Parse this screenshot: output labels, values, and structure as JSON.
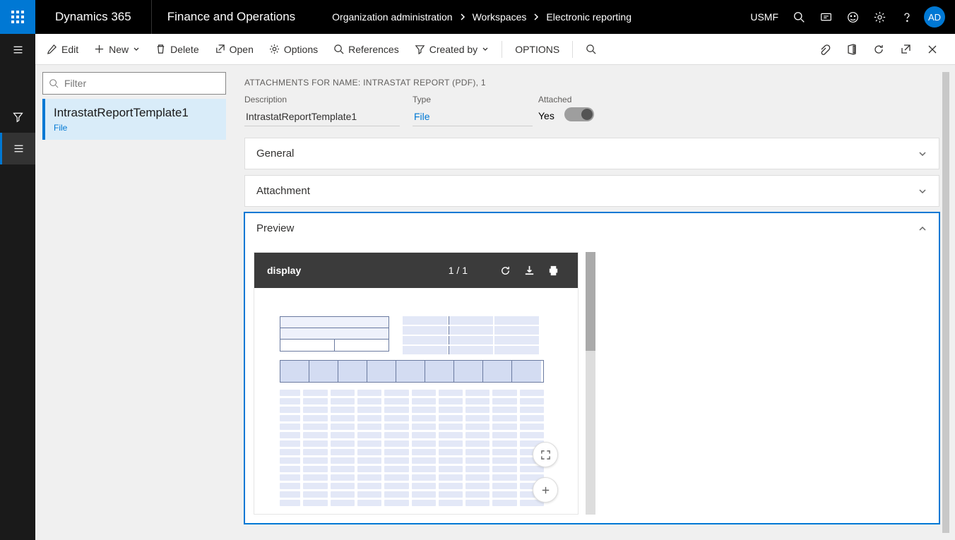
{
  "header": {
    "brand": "Dynamics 365",
    "module": "Finance and Operations",
    "breadcrumb": [
      "Organization administration",
      "Workspaces",
      "Electronic reporting"
    ],
    "entity": "USMF",
    "avatar": "AD"
  },
  "actionbar": {
    "edit": "Edit",
    "new": "New",
    "delete": "Delete",
    "open": "Open",
    "options": "Options",
    "references": "References",
    "createdby": "Created by",
    "options2": "OPTIONS"
  },
  "filter": {
    "placeholder": "Filter"
  },
  "list": {
    "items": [
      {
        "name": "IntrastatReportTemplate1",
        "type": "File"
      }
    ]
  },
  "detail": {
    "header": "ATTACHMENTS FOR NAME: INTRASTAT REPORT (PDF), 1",
    "fields": {
      "description": {
        "label": "Description",
        "value": "IntrastatReportTemplate1"
      },
      "type": {
        "label": "Type",
        "value": "File"
      },
      "attached": {
        "label": "Attached",
        "value": "Yes"
      }
    },
    "sections": {
      "general": "General",
      "attachment": "Attachment",
      "preview": "Preview"
    },
    "pdf": {
      "name": "display",
      "page": "1 / 1"
    }
  }
}
